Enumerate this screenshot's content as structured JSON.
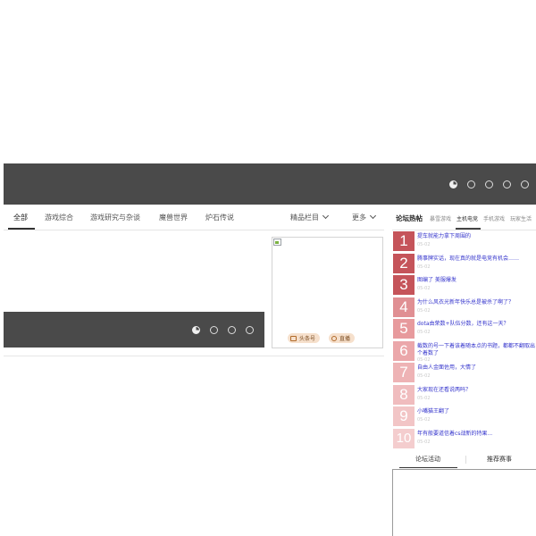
{
  "colors": {
    "banner": "#4a4a4a",
    "link": "#3333cc",
    "rank_top": "#c5545a",
    "rank_mid": "#e79a9d",
    "rank_low": "#f2c8c8"
  },
  "nav": {
    "tabs": [
      "全部",
      "游戏综合",
      "游戏研究与杂谈",
      "魔兽世界",
      "炉石传说"
    ],
    "dropdowns": [
      "精品栏目",
      "更多"
    ]
  },
  "video_card": {
    "badges": [
      {
        "icon": "tv-icon",
        "label": "头条号"
      },
      {
        "icon": "link-icon",
        "label": "直播"
      }
    ]
  },
  "forum": {
    "title": "论坛热帖",
    "tabs": [
      "暴雪游戏",
      "主机电竞",
      "手机游戏",
      "玩家生活"
    ],
    "items": [
      {
        "rank": "1",
        "title": "提车就能力拿下周围的",
        "meta": "05-02"
      },
      {
        "rank": "2",
        "title": "腾事牌实话，现在真的就是电竞有机会……",
        "meta": "05-02"
      },
      {
        "rank": "3",
        "title": "图编了 美服爆发",
        "meta": "05-02"
      },
      {
        "rank": "4",
        "title": "为什么风衣光新年快乐总是被杀了啊了？",
        "meta": "05-02"
      },
      {
        "rank": "5",
        "title": "dota由荣数+队伍分数，还有这一天？",
        "meta": "05-02"
      },
      {
        "rank": "6",
        "title": "截数的号一下着该着随本点的书题，都都不翻取出个着数了",
        "meta": "05-02"
      },
      {
        "rank": "7",
        "title": "自由人金面佐用，大情了",
        "meta": "05-02"
      },
      {
        "rank": "8",
        "title": "大家现在还看说两吗？",
        "meta": "05-02"
      },
      {
        "rank": "9",
        "title": "小嘴猫王翻了",
        "meta": "05-02"
      },
      {
        "rank": "10",
        "title": "年有般要道信着cs战新的特果...",
        "meta": "05-02"
      }
    ]
  },
  "activity": {
    "tabs": [
      "论坛活动",
      "推荐赛事"
    ]
  }
}
